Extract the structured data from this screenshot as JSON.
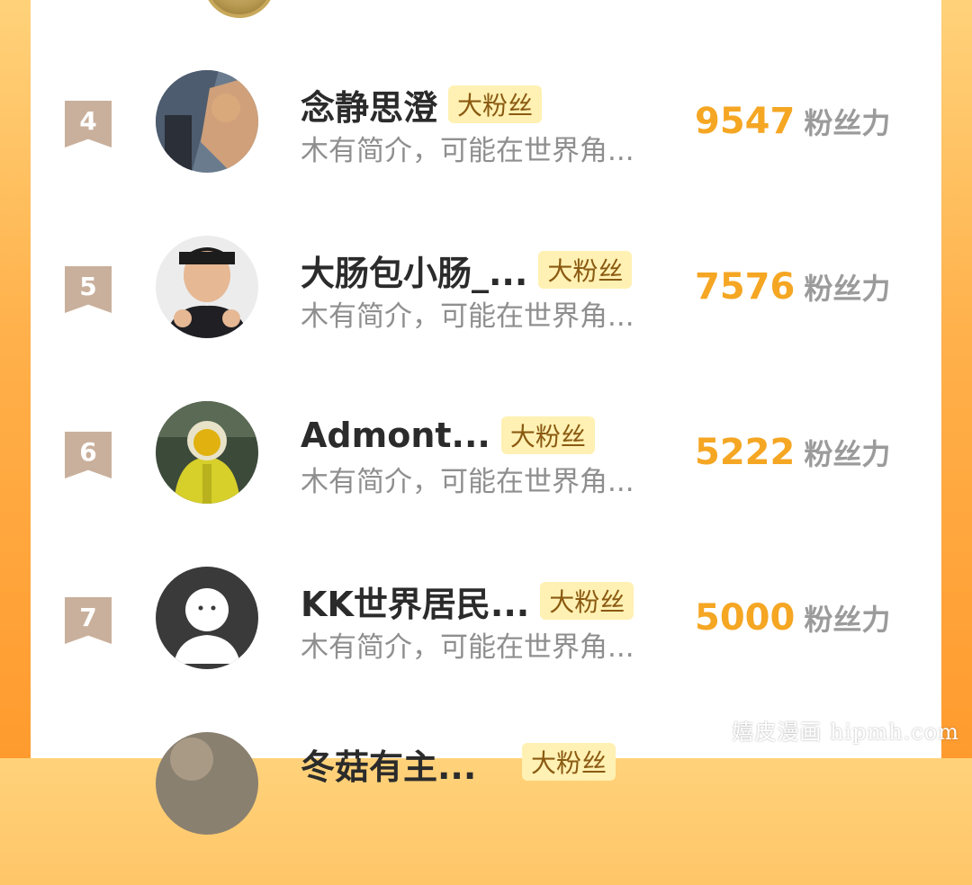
{
  "list": {
    "rows": [
      {
        "rank": "4",
        "name": "念静思澄",
        "badge": "大粉丝",
        "desc": "木有简介，可能在世界角...",
        "score": "9547",
        "unit": "粉丝力"
      },
      {
        "rank": "5",
        "name": "大肠包小肠_...",
        "badge": "大粉丝",
        "desc": "木有简介，可能在世界角...",
        "score": "7576",
        "unit": "粉丝力"
      },
      {
        "rank": "6",
        "name": "Admont...",
        "badge": "大粉丝",
        "desc": "木有简介，可能在世界角...",
        "score": "5222",
        "unit": "粉丝力"
      },
      {
        "rank": "7",
        "name": "KK世界居民...",
        "badge": "大粉丝",
        "desc": "木有简介，可能在世界角...",
        "score": "5000",
        "unit": "粉丝力"
      }
    ],
    "partial_row": {
      "name": "冬菇有主...",
      "badge": "大粉丝"
    }
  },
  "watermark": "嬉皮漫画 hipmh.com",
  "colors": {
    "accent": "#f5a623",
    "rank_bg": "#c9b09c",
    "badge_bg": "#fff1b3",
    "panel_bg": "#ffffff"
  }
}
